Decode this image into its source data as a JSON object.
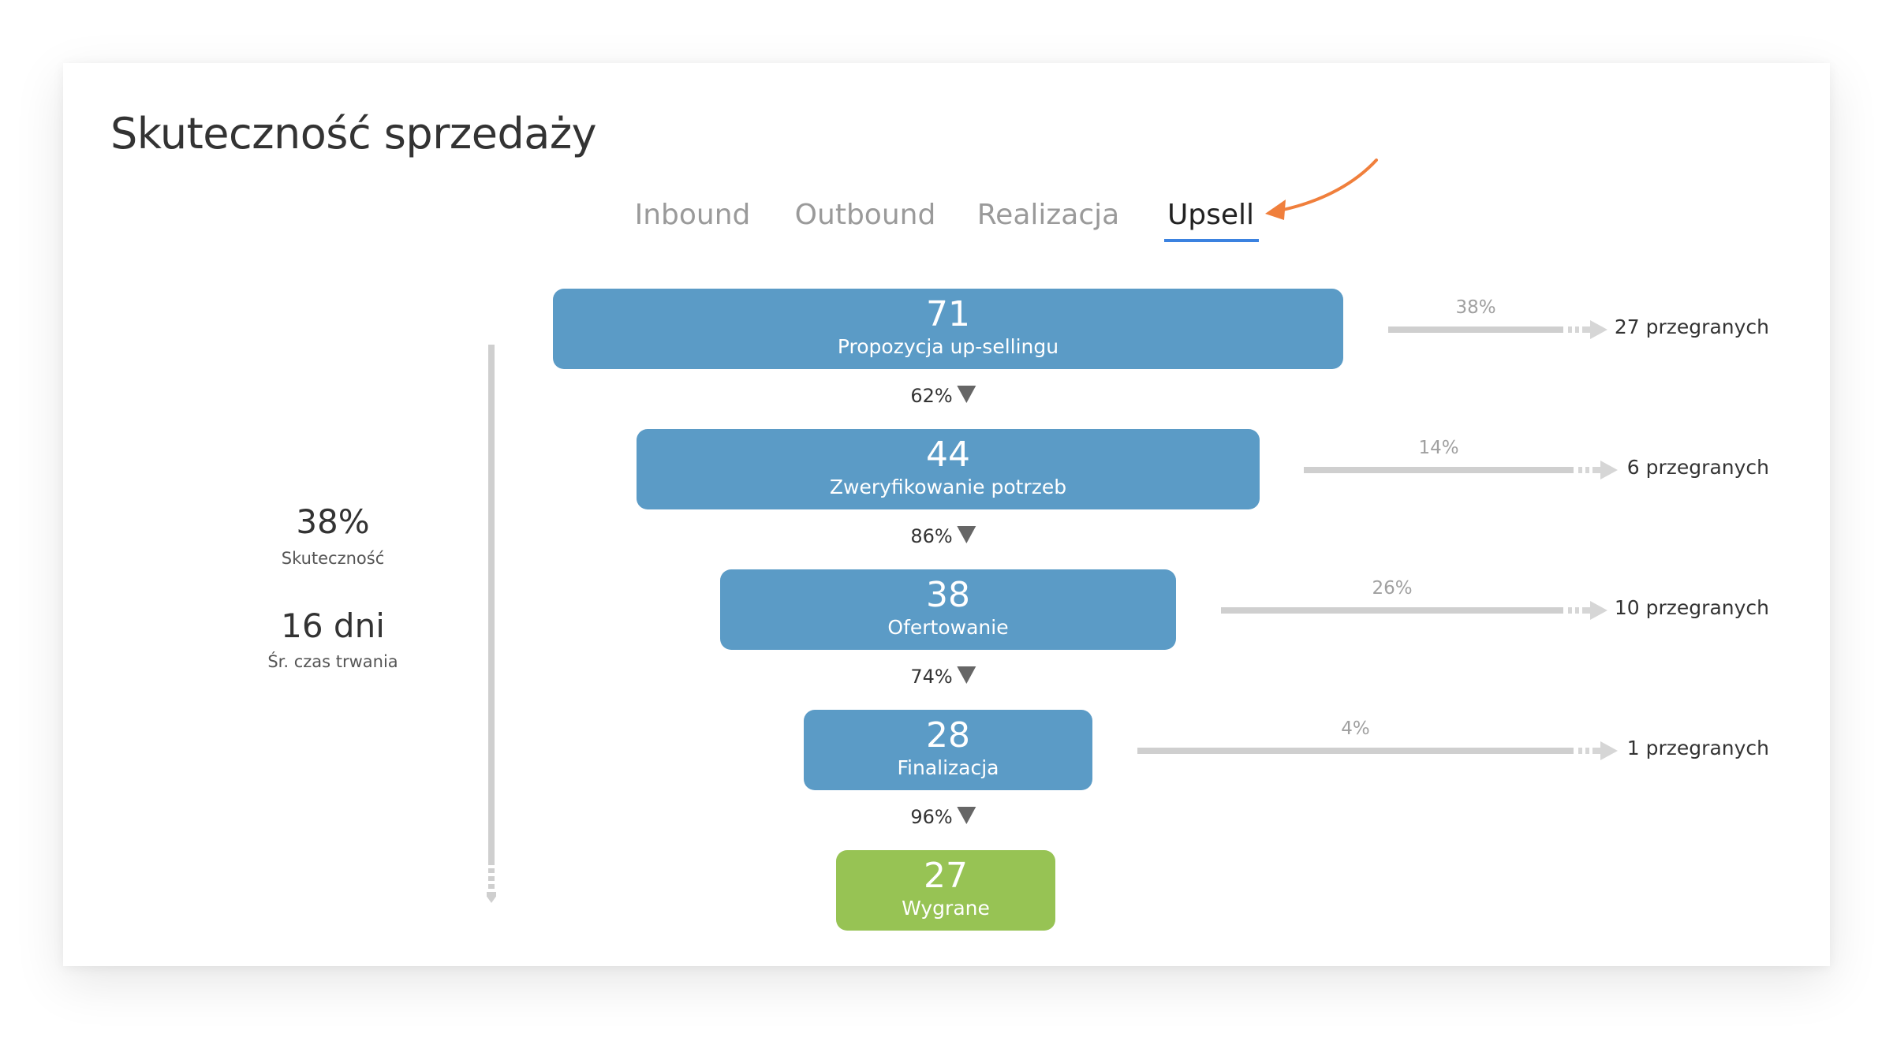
{
  "header": {
    "title": "Skuteczność sprzedaży"
  },
  "tabs": [
    {
      "label": "Inbound",
      "active": false
    },
    {
      "label": "Outbound",
      "active": false
    },
    {
      "label": "Realizacja",
      "active": false
    },
    {
      "label": "Upsell",
      "active": true
    }
  ],
  "colors": {
    "stage_blue": "#5b9bc6",
    "stage_green": "#97c354",
    "tab_underline": "#3b82e0",
    "annotation_arrow": "#f07f3c",
    "loss_bar": "#cfcfcf"
  },
  "summary": {
    "success_rate": "38%",
    "success_rate_label": "Skuteczność",
    "avg_duration": "16 dni",
    "avg_duration_label": "Śr. czas trwania"
  },
  "chart_data": {
    "type": "funnel",
    "title": "Skuteczność sprzedaży",
    "selected_tab": "Upsell",
    "stages": [
      {
        "name": "Propozycja up-sellingu",
        "value": 71,
        "status": "open"
      },
      {
        "name": "Zweryfikowanie potrzeb",
        "value": 44,
        "status": "open"
      },
      {
        "name": "Ofertowanie",
        "value": 38,
        "status": "open"
      },
      {
        "name": "Finalizacja",
        "value": 28,
        "status": "open"
      },
      {
        "name": "Wygrane",
        "value": 27,
        "status": "won"
      }
    ],
    "conversions": [
      "62%",
      "86%",
      "74%",
      "96%"
    ],
    "losses": [
      {
        "percent": "38%",
        "count": 27,
        "label": "27 przegranych"
      },
      {
        "percent": "14%",
        "count": 6,
        "label": "6 przegranych"
      },
      {
        "percent": "26%",
        "count": 10,
        "label": "10 przegranych"
      },
      {
        "percent": "4%",
        "count": 1,
        "label": "1 przegranych"
      }
    ]
  }
}
